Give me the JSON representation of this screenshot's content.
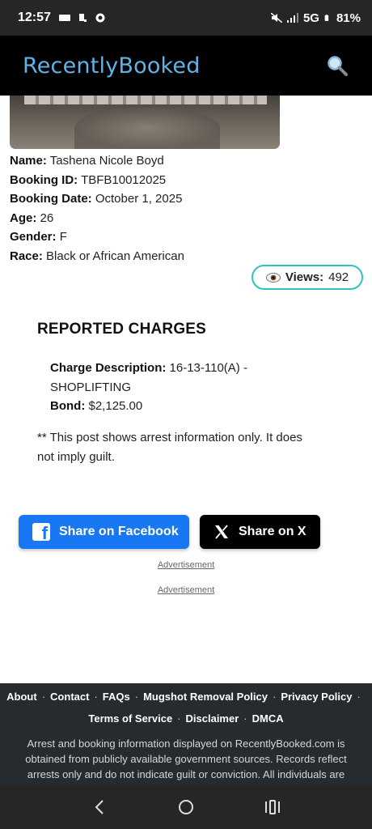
{
  "status_bar": {
    "time": "12:57",
    "network": "5G",
    "battery": "81%"
  },
  "header": {
    "title": "RecentlyBooked",
    "search_icon": "search-icon"
  },
  "record": {
    "fields": [
      {
        "label": "Name:",
        "value": "Tashena Nicole Boyd"
      },
      {
        "label": "Booking ID:",
        "value": "TBFB10012025"
      },
      {
        "label": "Booking Date:",
        "value": "October 1, 2025"
      },
      {
        "label": "Age:",
        "value": "26"
      },
      {
        "label": "Gender:",
        "value": "F"
      },
      {
        "label": "Race:",
        "value": "Black or African American"
      }
    ],
    "views_label": "Views:",
    "views_count": "492"
  },
  "charges": {
    "title": "REPORTED CHARGES",
    "description_label": "Charge Description:",
    "description_value": "16-13-110(A) - SHOPLIFTING",
    "bond_label": "Bond:",
    "bond_value": "$2,125.00",
    "disclaimer": "** This post shows arrest information only. It does not imply guilt."
  },
  "share": {
    "facebook_label": "Share on Facebook",
    "x_label": "Share on X"
  },
  "ads": [
    "Advertisement",
    "Advertisement"
  ],
  "footer": {
    "links": [
      "About",
      "Contact",
      "FAQs",
      "Mugshot Removal Policy",
      "Privacy Policy",
      "Terms of Service",
      "Disclaimer",
      "DMCA"
    ],
    "note": "Arrest and booking information displayed on RecentlyBooked.com is obtained from publicly available government sources. Records reflect arrests only and do not indicate guilt or conviction. All individuals are"
  },
  "colors": {
    "title_blue": "#5fb3e8",
    "views_border": "#2ec4c0",
    "facebook": "#1877f2",
    "footer_bg": "#262b30"
  }
}
